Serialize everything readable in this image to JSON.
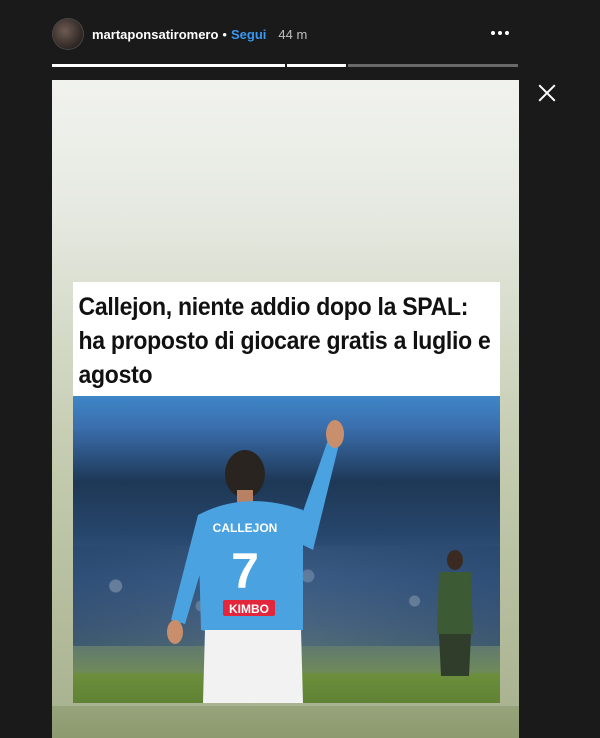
{
  "header": {
    "username": "martaponsatiromero",
    "separator": "•",
    "follow_label": "Segui",
    "time_ago": "44 m"
  },
  "story": {
    "progress": [
      {
        "fraction": 1.0
      },
      {
        "fraction": 1.0
      },
      {
        "fraction": 0.0
      }
    ],
    "headline": "Callejon, niente addio dopo la SPAL: ha proposto di giocare gratis a luglio e agosto",
    "jersey_name": "CALLEJON",
    "jersey_number": "7",
    "sponsor": "KIMBO"
  },
  "icons": {
    "more": "more-options-icon",
    "close": "close-icon"
  },
  "colors": {
    "background": "#1a1a1a",
    "follow": "#3897f0",
    "jersey": "#4aa3e0"
  }
}
